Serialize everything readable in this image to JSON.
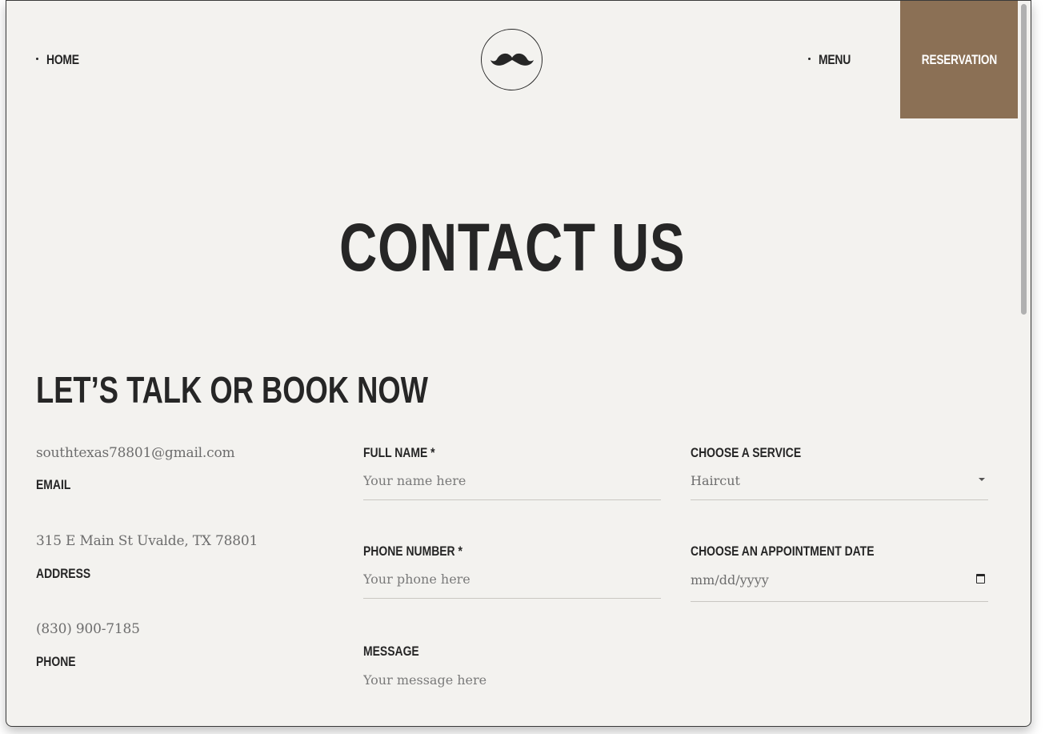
{
  "nav": {
    "home": "HOME",
    "menu": "MENU",
    "reservation": "RESERVATION"
  },
  "logo": {
    "icon": "mustache-icon"
  },
  "hero": {
    "title": "CONTACT US"
  },
  "contact": {
    "section_title": "LET’S TALK OR BOOK NOW",
    "email_value": "southtexas78801@gmail.com",
    "email_label": "EMAIL",
    "address_value": "315 E Main St Uvalde, TX 78801",
    "address_label": "ADDRESS",
    "phone_value": "(830) 900-7185",
    "phone_label": "PHONE"
  },
  "form": {
    "full_name_label": "FULL NAME *",
    "full_name_placeholder": "Your name here",
    "phone_label": "PHONE NUMBER *",
    "phone_placeholder": "Your phone here",
    "message_label": "MESSAGE",
    "message_placeholder": "Your message here",
    "service_label": "CHOOSE A SERVICE",
    "service_value": "Haircut",
    "date_label": "CHOOSE AN APPOINTMENT DATE",
    "date_placeholder": "mm/dd/yyyy"
  },
  "colors": {
    "background": "#f3f2ef",
    "accent": "#8b7055",
    "text": "#262626",
    "muted": "#6d6d6d"
  }
}
